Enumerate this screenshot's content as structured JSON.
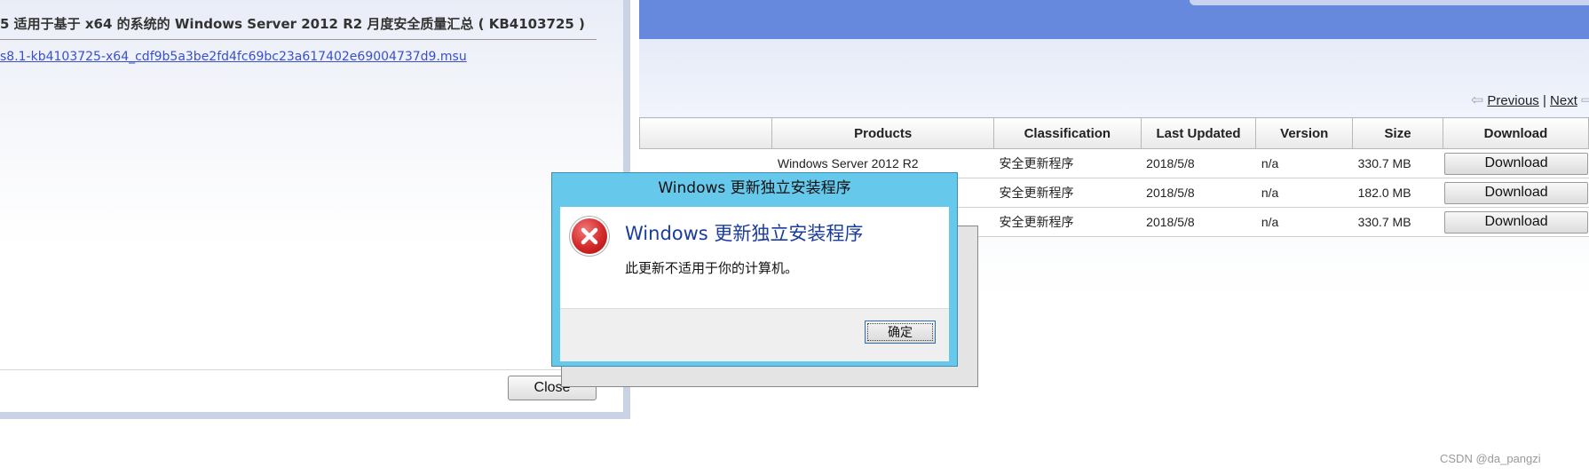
{
  "details": {
    "title": "5 适用于基于 x64 的系统的 Windows Server 2012 R2 月度安全质量汇总 ( KB4103725 )",
    "file_link": "s8.1-kb4103725-x64_cdf9b5a3be2fd4fc69bc23a617402e69004737d9.msu",
    "close_label": "Close"
  },
  "pager": {
    "previous_label": "Previous",
    "separator": "|",
    "next_label": "Next"
  },
  "table": {
    "headers": {
      "products": "Products",
      "classification": "Classification",
      "last_updated": "Last Updated",
      "version": "Version",
      "size": "Size",
      "download": "Download"
    },
    "rows": [
      {
        "product": "Windows Server 2012 R2",
        "classification": "安全更新程序",
        "last_updated": "2018/5/8",
        "version": "n/a",
        "size": "330.7 MB",
        "button": "Download"
      },
      {
        "product": "",
        "classification": "安全更新程序",
        "last_updated": "2018/5/8",
        "version": "n/a",
        "size": "182.0 MB",
        "button": "Download"
      },
      {
        "product": "",
        "classification": "安全更新程序",
        "last_updated": "2018/5/8",
        "version": "n/a",
        "size": "330.7 MB",
        "button": "Download"
      }
    ]
  },
  "dialog": {
    "window_title": "Windows 更新独立安装程序",
    "heading": "Windows 更新独立安装程序",
    "message": "此更新不适用于你的计算机。",
    "ok_label": "确定",
    "icon": "error-icon"
  },
  "watermark": "CSDN @da_pangzi",
  "colors": {
    "banner": "#6688dd",
    "dialog_frame": "#66c8ea",
    "dialog_heading": "#1a3c9c",
    "link": "#3a4fd0",
    "error_red": "#d42828"
  }
}
